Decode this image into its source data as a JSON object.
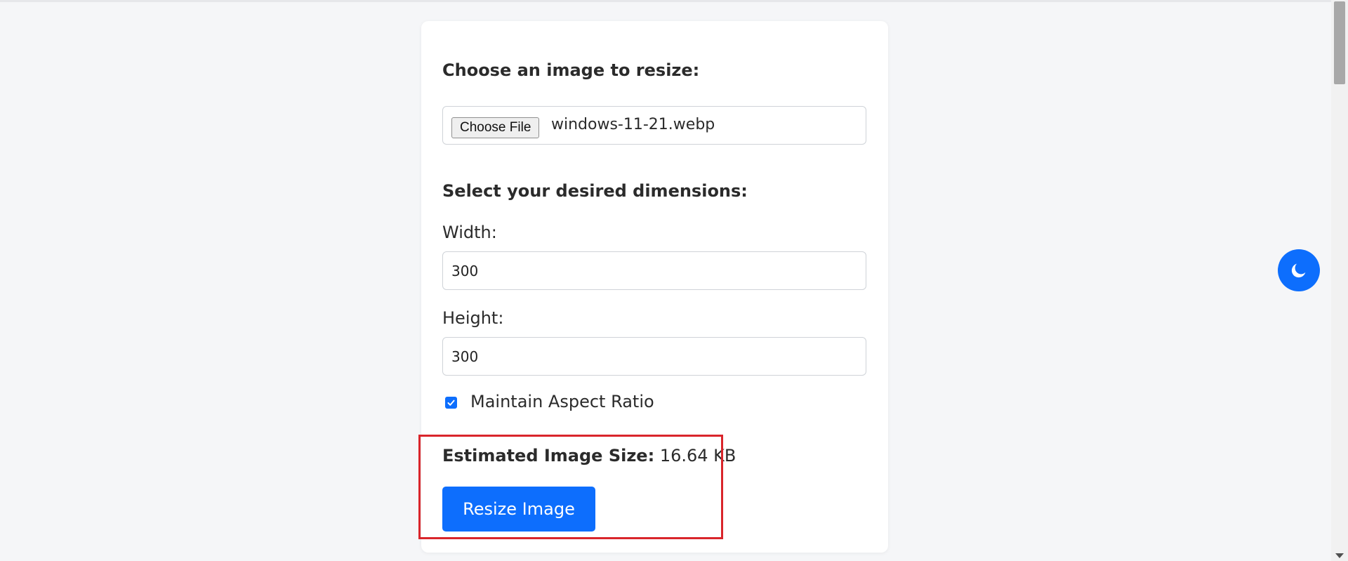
{
  "form": {
    "choose_heading": "Choose an image to resize:",
    "file_button_label": "Choose File",
    "file_name": "windows-11-21.webp",
    "dimensions_heading": "Select your desired dimensions:",
    "width_label": "Width:",
    "width_value": "300",
    "height_label": "Height:",
    "height_value": "300",
    "aspect_ratio_label": "Maintain Aspect Ratio",
    "aspect_ratio_checked": true,
    "estimate_label": "Estimated Image Size:",
    "estimate_value": "16.64 KB",
    "resize_button_label": "Resize Image"
  },
  "theme_toggle": {
    "icon": "moon-icon"
  },
  "colors": {
    "accent": "#0d6efd",
    "highlight": "#d9252b",
    "background": "#f5f6f8",
    "card": "#ffffff"
  }
}
